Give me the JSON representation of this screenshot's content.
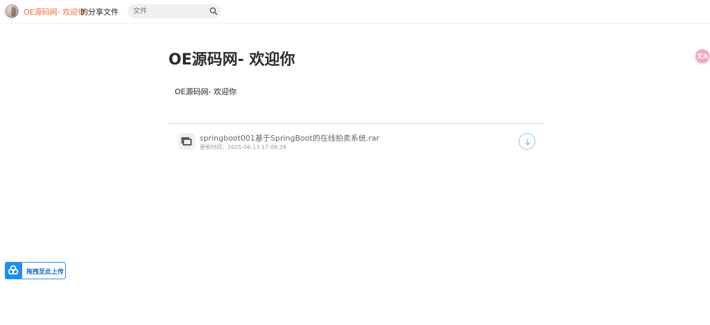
{
  "header": {
    "owner_name": "OE源码网- 欢迎你",
    "owner_suffix": "的分享文件",
    "search": {
      "placeholder": "文件",
      "value": ""
    }
  },
  "main": {
    "title": "OE源码网- 欢迎你",
    "description": "OE源码网- 欢迎你",
    "files": [
      {
        "name": "springboot001基于SpringBoot的在线拍卖系统.rar",
        "updated": "更新时间：2025-06-13 17:09:39",
        "icon": "folder-icon"
      }
    ]
  },
  "floating": {
    "translate_label": "文A",
    "upload_label": "拖拽至此上传"
  },
  "colors": {
    "owner_accent": "#f06a3a",
    "download_border": "#8fc7ef",
    "upload_blue": "#1d8ff0",
    "translate_pink": "#f6a6bd"
  }
}
